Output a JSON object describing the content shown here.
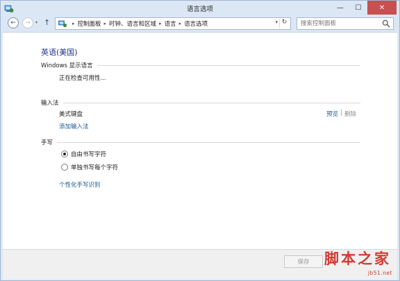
{
  "window": {
    "title": "语言选项",
    "minimize_glyph": "—",
    "maximize_glyph": "☐",
    "close_glyph": "✕"
  },
  "nav": {
    "back_glyph": "←",
    "forward_glyph": "→",
    "up_glyph": "↑",
    "dropdown_glyph": "▾",
    "refresh_glyph": "↻"
  },
  "breadcrumb": {
    "separator": "▸",
    "items": [
      "控制面板",
      "时钟、语言和区域",
      "语言",
      "语言选项"
    ]
  },
  "search": {
    "placeholder": "搜索控制面板"
  },
  "language": {
    "title": "英语(美国)"
  },
  "windows_display": {
    "header": "Windows 显示语言",
    "status": "正在检查可用性..."
  },
  "input_method": {
    "header": "输入法",
    "keyboard": "美式键盘",
    "preview": "预览",
    "separator": "|",
    "remove": "删除",
    "add": "添加输入法"
  },
  "handwriting": {
    "header": "手写",
    "option_free": "自由书写字符",
    "option_single": "单独书写每个字符",
    "selected": "自由书写字符",
    "personalize": "个性化手写识别"
  },
  "footer": {
    "save": "保存"
  },
  "watermark": {
    "main": "脚本之家",
    "sub": "jb51.net"
  },
  "colors": {
    "title_blue": "#1e3287",
    "link_blue": "#1c5a96",
    "close_red": "#c75050",
    "frame": "#dbe7f4",
    "watermark_red": "#d2271c"
  }
}
